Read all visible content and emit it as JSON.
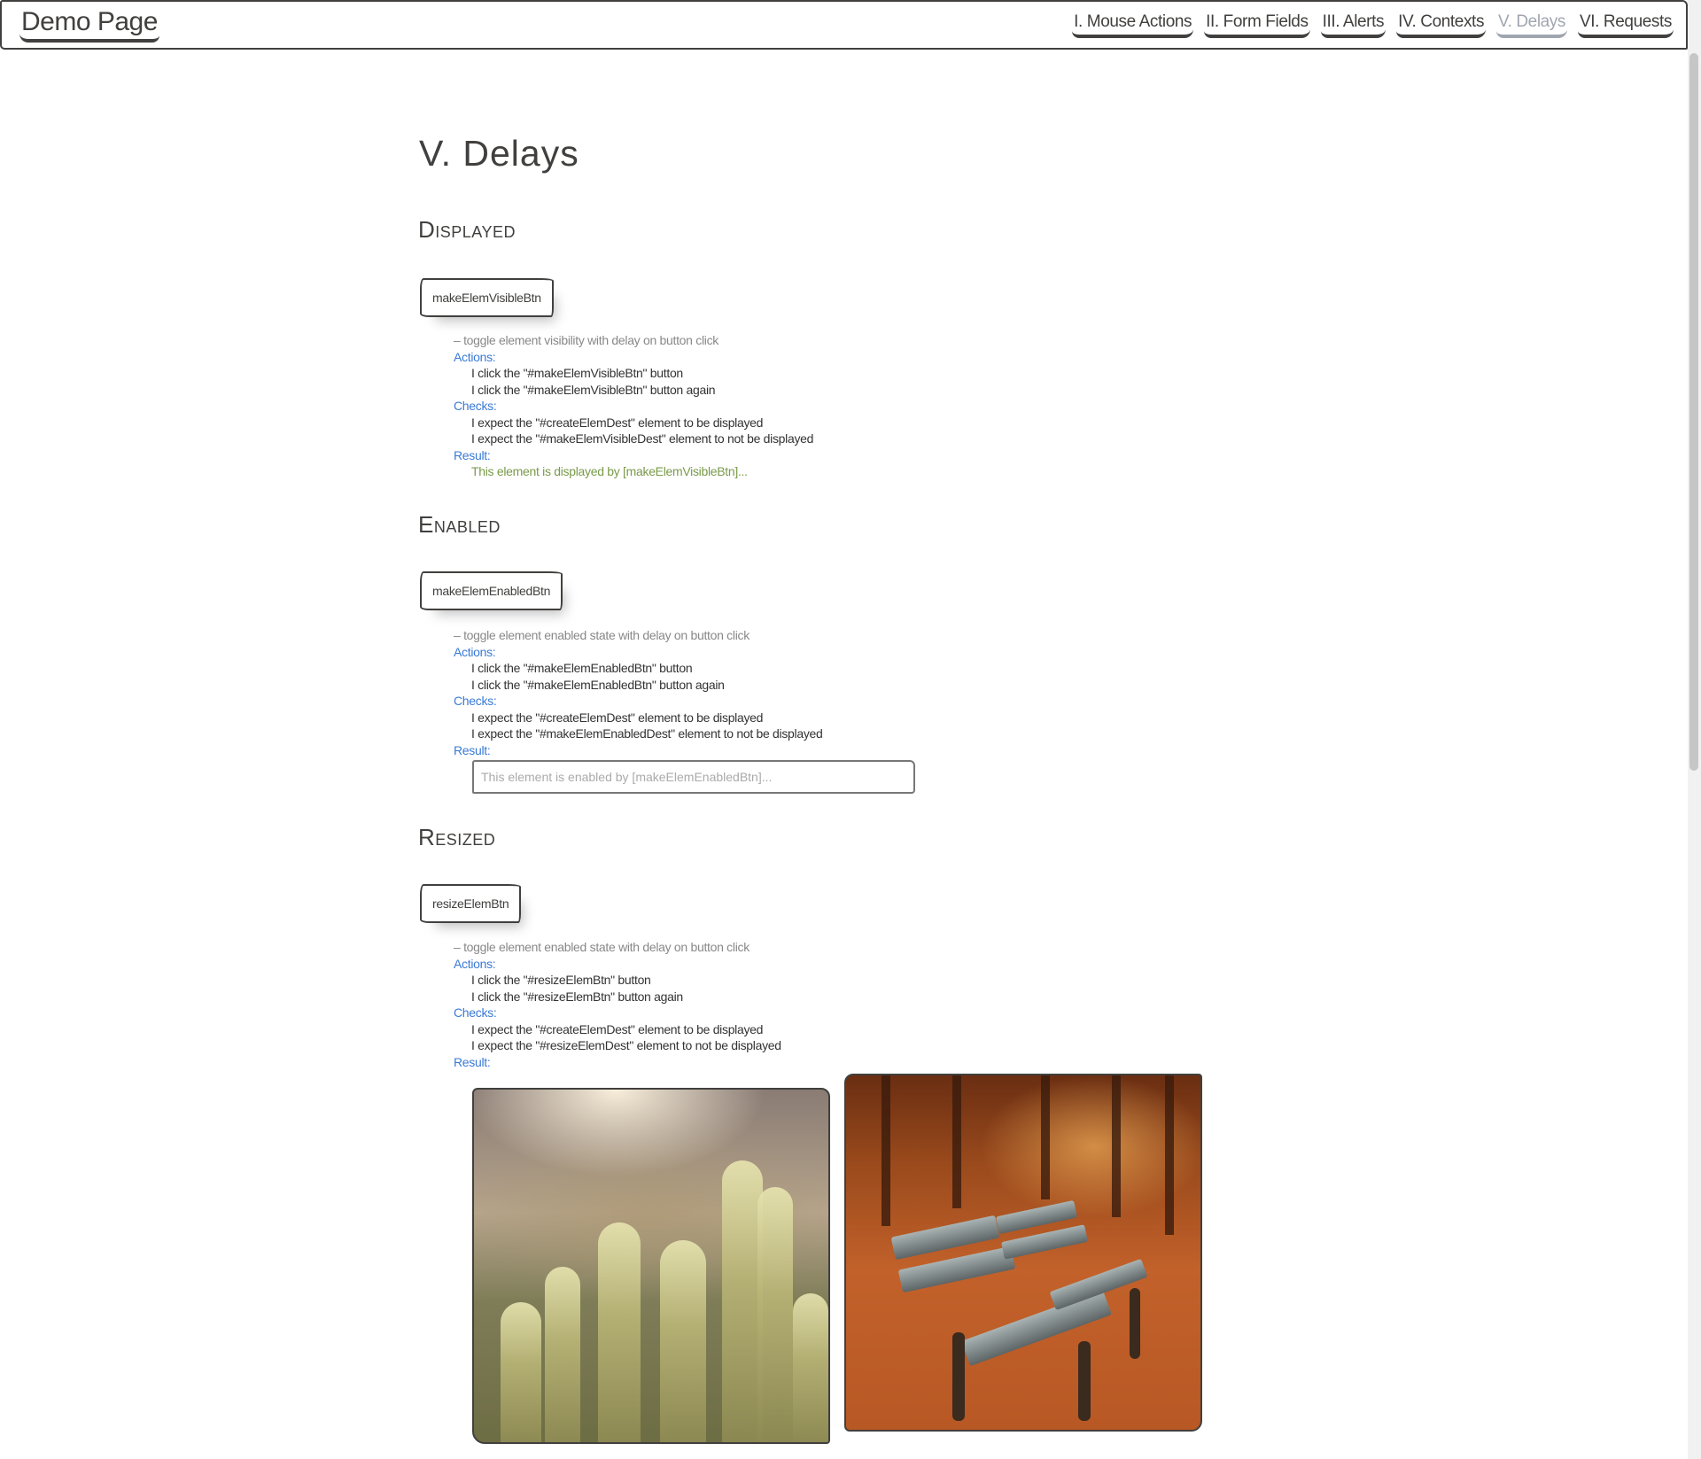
{
  "navbar": {
    "brand": "Demo Page",
    "links": [
      {
        "label": "I. Mouse Actions",
        "active": false
      },
      {
        "label": "II. Form Fields",
        "active": false
      },
      {
        "label": "III. Alerts",
        "active": false
      },
      {
        "label": "IV. Contexts",
        "active": false
      },
      {
        "label": "V. Delays",
        "active": true
      },
      {
        "label": "VI. Requests",
        "active": false
      }
    ]
  },
  "page": {
    "title": "V. Delays"
  },
  "sections": {
    "displayed": {
      "title": "Displayed",
      "button": "makeElemVisibleBtn",
      "comment": "– toggle element visibility with delay on button click",
      "actions_label": "Actions:",
      "actions": [
        "I click the \"#makeElemVisibleBtn\" button",
        "I click the \"#makeElemVisibleBtn\" button again"
      ],
      "checks_label": "Checks:",
      "checks": [
        "I expect the \"#createElemDest\" element to be displayed",
        "I expect the \"#makeElemVisibleDest\" element to not be displayed"
      ],
      "result_label": "Result:",
      "result": "This element is displayed by [makeElemVisibleBtn]..."
    },
    "enabled": {
      "title": "Enabled",
      "button": "makeElemEnabledBtn",
      "comment": "– toggle element enabled state with delay on button click",
      "actions_label": "Actions:",
      "actions": [
        "I click the \"#makeElemEnabledBtn\" button",
        "I click the \"#makeElemEnabledBtn\" button again"
      ],
      "checks_label": "Checks:",
      "checks": [
        "I expect the \"#createElemDest\" element to be displayed",
        "I expect the \"#makeElemEnabledDest\" element to not be displayed"
      ],
      "result_label": "Result:",
      "result_placeholder": "This element is enabled by [makeElemEnabledBtn]..."
    },
    "resized": {
      "title": "Resized",
      "button": "resizeElemBtn",
      "comment": "– toggle element enabled state with delay on button click",
      "actions_label": "Actions:",
      "actions": [
        "I click the \"#resizeElemBtn\" button",
        "I click the \"#resizeElemBtn\" button again"
      ],
      "checks_label": "Checks:",
      "checks": [
        "I expect the \"#createElemDest\" element to be displayed",
        "I expect the \"#resizeElemDest\" element to not be displayed"
      ],
      "result_label": "Result:",
      "images": [
        "cactus-photo",
        "autumn-bench-photo"
      ]
    }
  },
  "colors": {
    "ink": "#41403e",
    "keyword": "#3a7ad6",
    "comment": "#888888",
    "result": "#7a9a4a",
    "active_nav": "#a0a6b0"
  }
}
